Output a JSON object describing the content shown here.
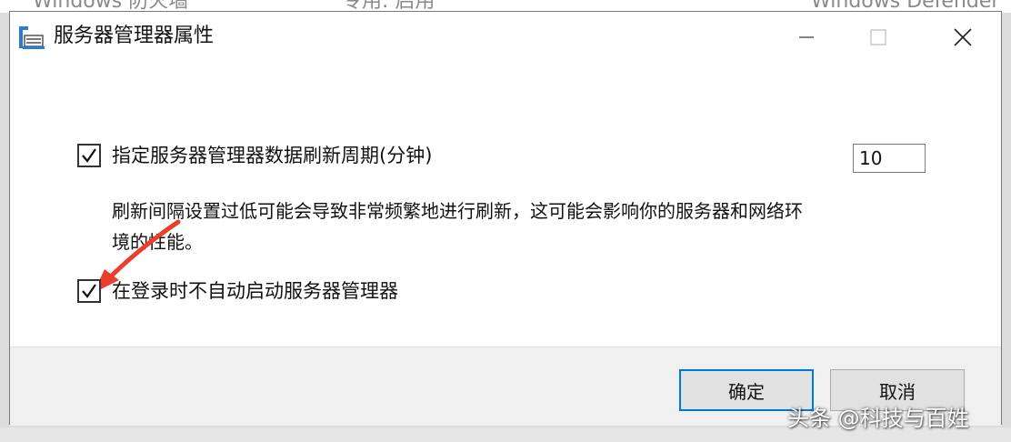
{
  "background_window": {
    "col1": "Windows 防火墙",
    "col2": "专用: 启用",
    "col3": "Windows Defender"
  },
  "dialog": {
    "title": "服务器管理器属性",
    "option_refresh": {
      "checked": true,
      "label": "指定服务器管理器数据刷新周期(分钟)",
      "value": "10"
    },
    "description": "刷新间隔设置过低可能会导致非常频繁地进行刷新，这可能会影响你的服务器和网络环境的性能。",
    "option_no_autostart": {
      "checked": true,
      "label": "在登录时不自动启动服务器管理器"
    },
    "ok_label": "确定",
    "cancel_label": "取消"
  },
  "watermark": "头条 @科技与百姓",
  "colors": {
    "accent": "#0078d7",
    "arrow": "#e8402a"
  },
  "icons": [
    "server-manager-icon",
    "minimize-icon",
    "maximize-icon",
    "close-icon",
    "checkmark-icon",
    "annotation-arrow-icon"
  ]
}
